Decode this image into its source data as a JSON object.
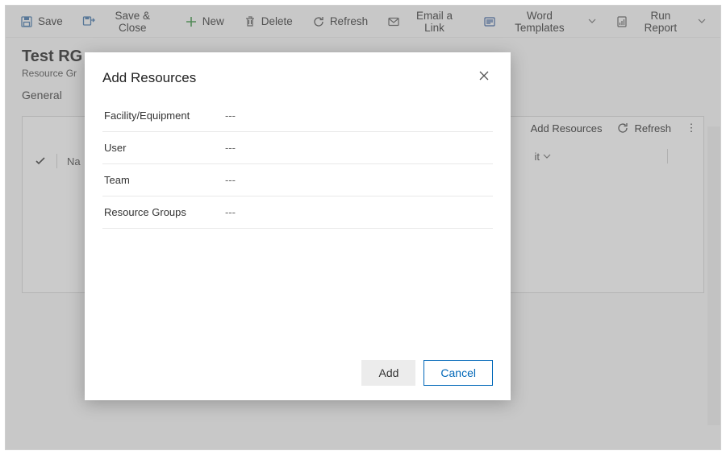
{
  "toolbar": {
    "save": "Save",
    "save_close": "Save & Close",
    "new": "New",
    "delete": "Delete",
    "refresh": "Refresh",
    "email_link": "Email a Link",
    "word_templates": "Word Templates",
    "run_report": "Run Report"
  },
  "page": {
    "title": "Test RG",
    "subtitle": "Resource Gr",
    "tabs": {
      "general": "General"
    }
  },
  "subgrid": {
    "add_resources": "Add Resources",
    "refresh": "Refresh",
    "more": "⋮",
    "col_name_partial": "Na",
    "select_suffix": "it"
  },
  "modal": {
    "title": "Add Resources",
    "fields": [
      {
        "label": "Facility/Equipment",
        "value": "---"
      },
      {
        "label": "User",
        "value": "---"
      },
      {
        "label": "Team",
        "value": "---"
      },
      {
        "label": "Resource Groups",
        "value": "---"
      }
    ],
    "add": "Add",
    "cancel": "Cancel"
  }
}
